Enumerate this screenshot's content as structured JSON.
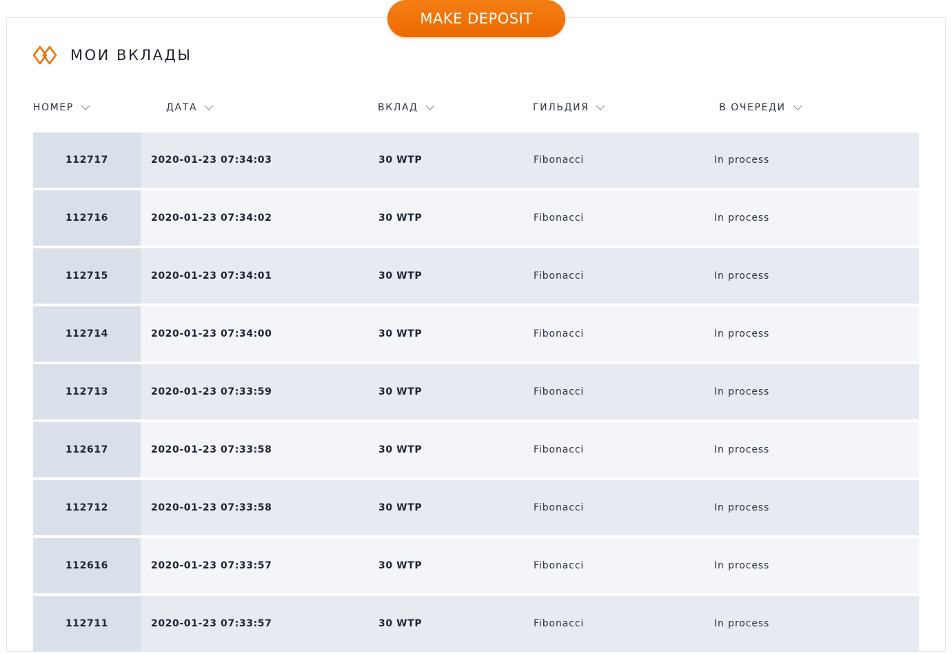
{
  "header": {
    "deposit_button": "MAKE DEPOSIT",
    "title": "МОИ ВКЛАДЫ",
    "logo_icon": "diamond-logo-icon",
    "accent_color": "#ee7000"
  },
  "table": {
    "columns": [
      {
        "key": "id",
        "label": "НОМЕР"
      },
      {
        "key": "date",
        "label": "ДАТА"
      },
      {
        "key": "amount",
        "label": "ВКЛАД"
      },
      {
        "key": "guild",
        "label": "ГИЛЬДИЯ"
      },
      {
        "key": "status",
        "label": "В ОЧЕРЕДИ"
      }
    ],
    "sort_icon": "chevron-down-icon",
    "rows": [
      {
        "id": "112717",
        "date": "2020-01-23 07:34:03",
        "amount": "30 WTP",
        "guild": "Fibonacci",
        "status": "In process"
      },
      {
        "id": "112716",
        "date": "2020-01-23 07:34:02",
        "amount": "30 WTP",
        "guild": "Fibonacci",
        "status": "In process"
      },
      {
        "id": "112715",
        "date": "2020-01-23 07:34:01",
        "amount": "30 WTP",
        "guild": "Fibonacci",
        "status": "In process"
      },
      {
        "id": "112714",
        "date": "2020-01-23 07:34:00",
        "amount": "30 WTP",
        "guild": "Fibonacci",
        "status": "In process"
      },
      {
        "id": "112713",
        "date": "2020-01-23 07:33:59",
        "amount": "30 WTP",
        "guild": "Fibonacci",
        "status": "In process"
      },
      {
        "id": "112617",
        "date": "2020-01-23 07:33:58",
        "amount": "30 WTP",
        "guild": "Fibonacci",
        "status": "In process"
      },
      {
        "id": "112712",
        "date": "2020-01-23 07:33:58",
        "amount": "30 WTP",
        "guild": "Fibonacci",
        "status": "In process"
      },
      {
        "id": "112616",
        "date": "2020-01-23 07:33:57",
        "amount": "30 WTP",
        "guild": "Fibonacci",
        "status": "In process"
      },
      {
        "id": "112711",
        "date": "2020-01-23 07:33:57",
        "amount": "30 WTP",
        "guild": "Fibonacci",
        "status": "In process"
      }
    ]
  }
}
